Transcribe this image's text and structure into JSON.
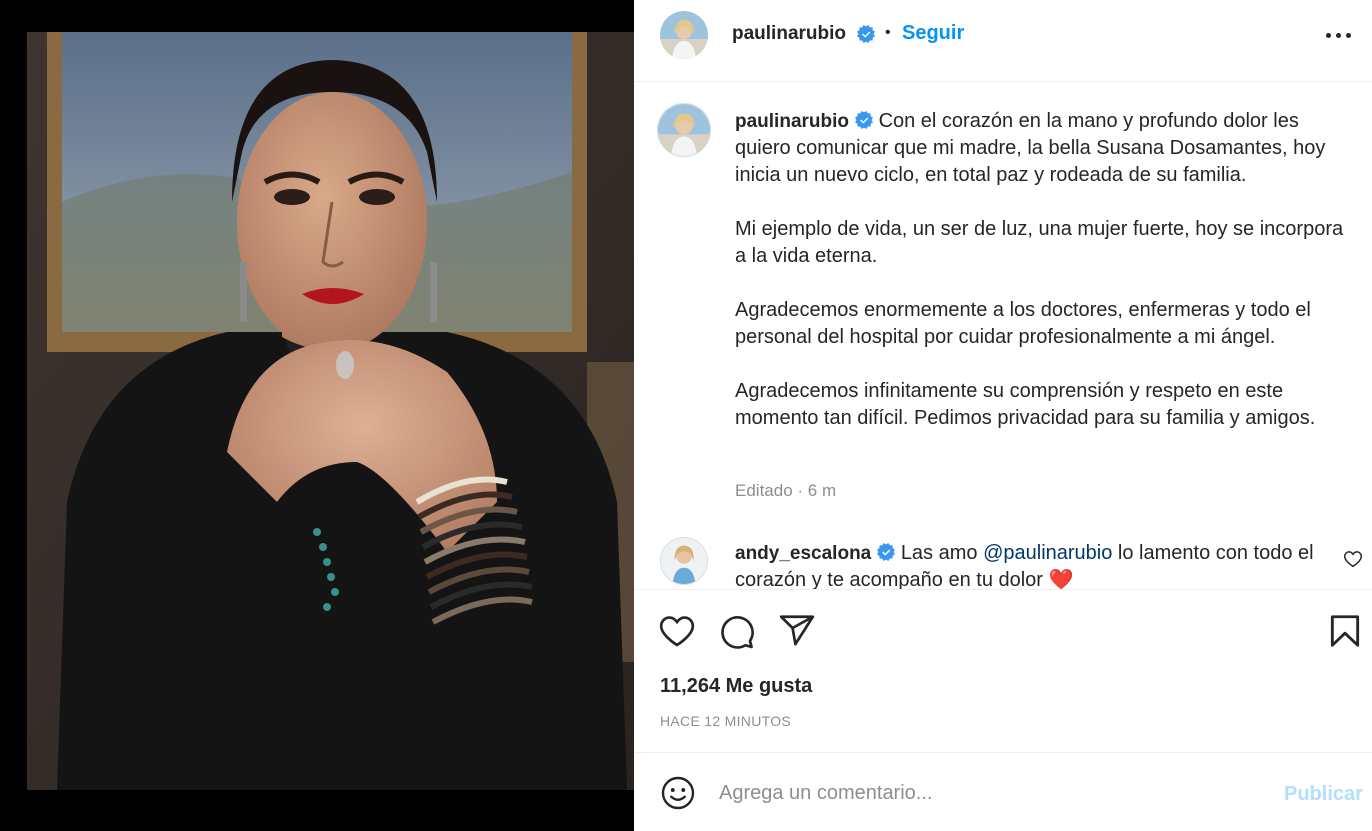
{
  "post": {
    "username": "paulinarubio",
    "verified_icon": "verified-badge-icon",
    "separator": "•",
    "follow_label": "Seguir",
    "more_icon": "more-options-icon",
    "caption_paragraphs": [
      "Con el corazón en la mano y profundo dolor les quiero comunicar que mi madre, la bella Susana Dosamantes, hoy inicia un nuevo ciclo, en total paz y rodeada de su familia.",
      "Mi ejemplo de vida, un ser de luz, una mujer fuerte, hoy se incorpora a la vida eterna.",
      "Agradecemos enormemente a los doctores, enfermeras y todo el personal del hospital por cuidar profesionalmente a mi ángel.",
      "Agradecemos infinitamente su comprensión y respeto en este momento tan difícil. Pedimos privacidad para su familia y amigos."
    ],
    "caption_meta": "Editado · 6 m"
  },
  "comments": [
    {
      "username": "andy_escalona",
      "text_before": "Las amo ",
      "mention": "@paulinarubio",
      "text_after": " lo lamento con todo el corazón y te acompaño en tu dolor ❤️"
    }
  ],
  "actions": {
    "icons": [
      "heart-icon",
      "comment-icon",
      "share-icon",
      "bookmark-icon"
    ],
    "likes": "11,264 Me gusta",
    "timestamp": "HACE 12 MINUTOS"
  },
  "add_comment": {
    "placeholder": "Agrega un comentario...",
    "publish_label": "Publicar",
    "emoji_icon": "emoji-icon"
  },
  "colors": {
    "accent": "#0095f6",
    "publish_disabled": "#b2dffc",
    "text": "#262626",
    "muted": "#8e8e8e",
    "mention": "#00376b",
    "heart_emoji": "#e0245e"
  }
}
